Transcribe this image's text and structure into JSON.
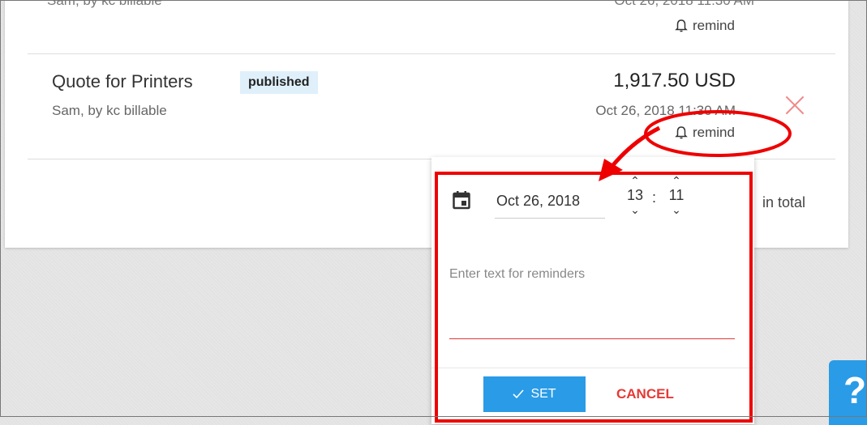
{
  "previous_row": {
    "customer_clipped": "Sam, by kc billable",
    "timestamp_clipped": "Oct 26, 2018 11:30 AM",
    "remind_label": "remind"
  },
  "quote_row": {
    "title": "Quote for Printers",
    "status_badge": "published",
    "customer": "Sam, by kc billable",
    "amount": "1,917.50 USD",
    "timestamp": "Oct 26, 2018 11:30 AM",
    "remind_label": "remind",
    "delete_icon": "close-icon"
  },
  "footer": {
    "in_total_label": "in total"
  },
  "reminder_popup": {
    "date": "Oct 26, 2018",
    "hour": "13",
    "minute": "11",
    "time_separator": ":",
    "text_placeholder": "Enter text for reminders",
    "set_label": "SET",
    "cancel_label": "CANCEL",
    "icons": [
      "calendar-icon",
      "chevron-up-icon",
      "chevron-down-icon",
      "check-icon"
    ]
  },
  "help_tab": {
    "label": "?"
  },
  "annotation": {
    "color": "#ee0000"
  },
  "colors": {
    "accent": "#2a9be6",
    "danger": "#e53935",
    "badge_bg": "#dff0fb"
  }
}
